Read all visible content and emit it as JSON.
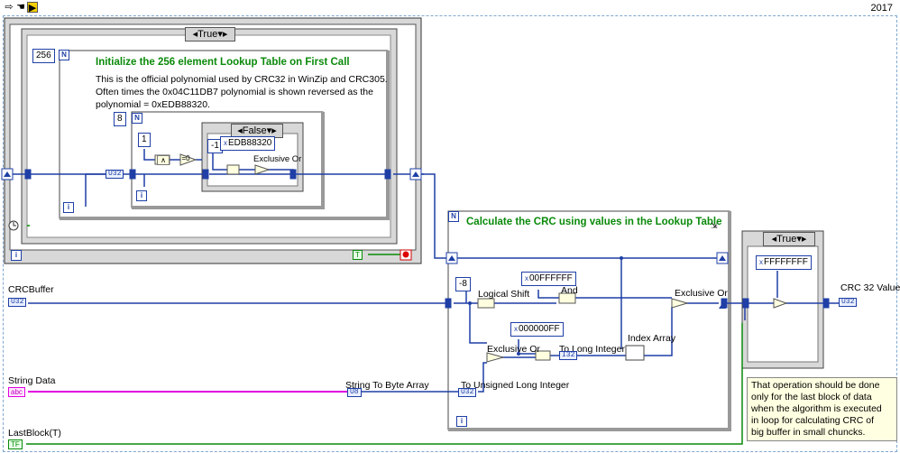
{
  "toolbar": {
    "version": "2017"
  },
  "outer_case": {
    "selector": "True"
  },
  "init_loop": {
    "count": "256",
    "title": "Initialize the 256 element Lookup Table on First Call",
    "description_lines": [
      "This is the official polynomial used by CRC32 in WinZip and CRC305.",
      "Often times the 0x04C11DB7 polynomial is shown reversed as the",
      "polynomial  = 0xEDB88320."
    ]
  },
  "inner_loop": {
    "count": "8",
    "constant_1": "1"
  },
  "inner_case": {
    "selector": "False",
    "minus_one": "-1",
    "poly": "EDB88320",
    "xor_label": "Exclusive Or"
  },
  "calc_loop": {
    "title": "Calculate the CRC using values in the Lookup Table",
    "shift_const": "-8",
    "shift_label": "Logical Shift",
    "mask1": "00FFFFFF",
    "and_label": "And",
    "mask2": "000000FF",
    "xor1_label": "Exclusive Or",
    "xor2_label": "Exclusive Or",
    "to_long_label": "To Long Integer",
    "index_label": "Index Array",
    "u32_label": "To Unsigned Long Integer",
    "str2byte_label": "String To Byte Array"
  },
  "final_case": {
    "selector": "True",
    "mask": "FFFFFFFF"
  },
  "controls": {
    "crc_buffer": "CRCBuffer",
    "string_data": "String Data",
    "last_block": "LastBlock(T)",
    "crc_value": "CRC 32 Value"
  },
  "note": {
    "lines": [
      "That operation should be done",
      "only for the  last block of data",
      "when the algorithm is executed",
      "in loop for calculating CRC of",
      "big buffer in small chuncks."
    ]
  },
  "colors": {
    "wire_int": "#1f3fa6",
    "wire_str": "#e000e0",
    "wire_bool": "#0a8a0a",
    "comment": "#0a8a0a"
  }
}
